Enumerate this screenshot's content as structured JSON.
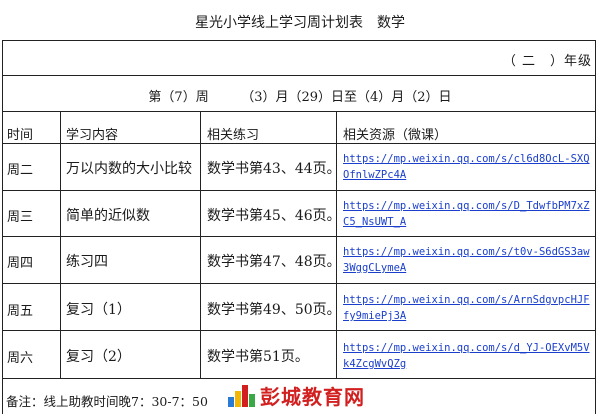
{
  "title": "星光小学线上学习周计划表　数学",
  "grade": "（ 二　）年级",
  "week_line": "第（7）周　　　（3）月（29）日至（4）月（2）日",
  "headers": {
    "day": "时间",
    "topic": "学习内容",
    "exercise": "相关练习",
    "resource": "相关资源（微课）"
  },
  "rows": [
    {
      "day": "周二",
      "topic": "万以内数的大小比较",
      "exercise": "数学书第43、44页。",
      "link": "https://mp.weixin.qq.com/s/cl6d8OcL-SXQOfnlwZPc4A"
    },
    {
      "day": "周三",
      "topic": "简单的近似数",
      "exercise": "数学书第45、46页。",
      "link": "https://mp.weixin.qq.com/s/D_TdwfbPM7xZC5_NsUWT_A"
    },
    {
      "day": "周四",
      "topic": "练习四",
      "exercise": "数学书第47、48页。",
      "link": "https://mp.weixin.qq.com/s/t0v-S6dGS3aw3WggCLymeA"
    },
    {
      "day": "周五",
      "topic": "复习（1）",
      "exercise": "数学书第49、50页。",
      "link": "https://mp.weixin.qq.com/s/ArnSdgvpcHJFfy9miePj3A"
    },
    {
      "day": "周六",
      "topic": "复习（2）",
      "exercise": "数学书第51页。",
      "link": "https://mp.weixin.qq.com/s/d_YJ-OEXvM5Vk4ZcgWvQZg"
    }
  ],
  "note": "备注：线上助教时间晚7：30-7：50",
  "watermark": "彭城教育网",
  "colors": {
    "link": "#1a3fcc",
    "watermark": "#d21f1f",
    "grid": "#222222"
  }
}
